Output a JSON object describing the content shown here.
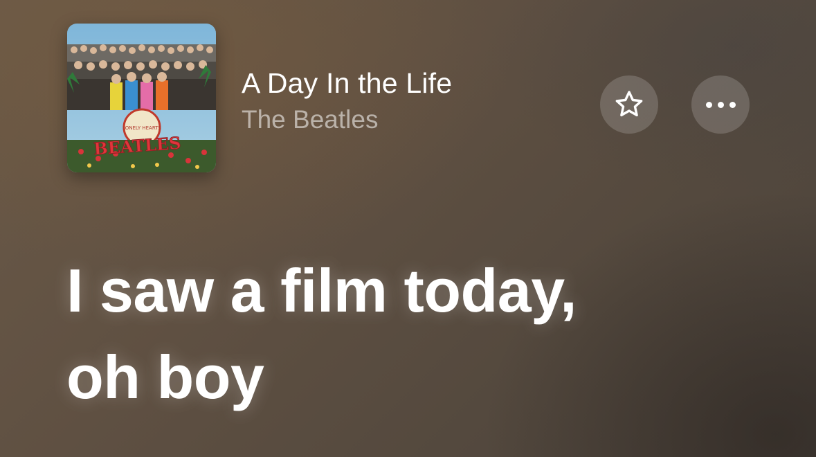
{
  "now_playing": {
    "title": "A Day In the Life",
    "artist": "The Beatles",
    "album_art": {
      "icon": "album-cover",
      "cover_text": "BEATLES",
      "badge_text": "LONELY HEARTS"
    }
  },
  "actions": {
    "favorite_icon": "star-outline-icon",
    "more_icon": "ellipsis-icon"
  },
  "lyrics": {
    "current_lines": [
      "I saw a film today,",
      "oh boy"
    ]
  },
  "colors": {
    "text_primary": "#ffffff",
    "text_secondary": "rgba(255,255,255,0.55)",
    "button_bg": "rgba(255,255,255,0.17)",
    "background": "#5f5042"
  }
}
